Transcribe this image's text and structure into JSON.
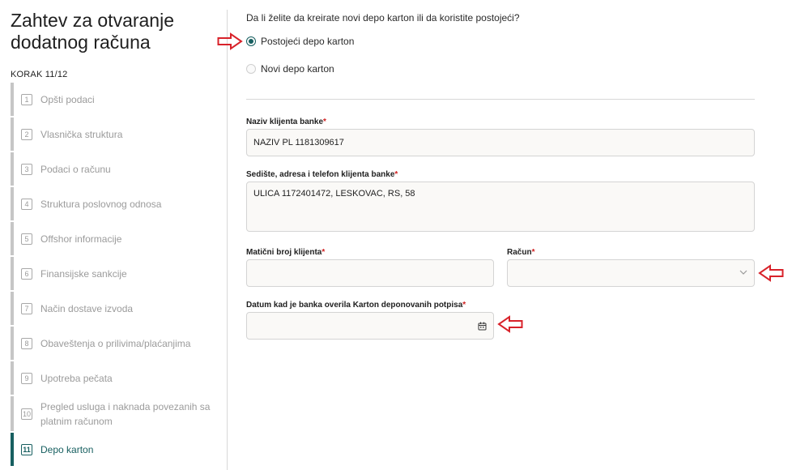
{
  "sidebar": {
    "title": "Zahtev za otvaranje dodatnog računa",
    "step_counter": "KORAK 11/12",
    "steps": [
      {
        "num": "1",
        "label": "Opšti podaci"
      },
      {
        "num": "2",
        "label": "Vlasnička struktura"
      },
      {
        "num": "3",
        "label": "Podaci o računu"
      },
      {
        "num": "4",
        "label": "Struktura poslovnog odnosa"
      },
      {
        "num": "5",
        "label": "Offshor informacije"
      },
      {
        "num": "6",
        "label": "Finansijske sankcije"
      },
      {
        "num": "7",
        "label": "Način dostave izvoda"
      },
      {
        "num": "8",
        "label": "Obaveštenja o prilivima/plaćanjima"
      },
      {
        "num": "9",
        "label": "Upotreba pečata"
      },
      {
        "num": "10",
        "label": "Pregled usluga i naknada povezanih sa platnim računom"
      },
      {
        "num": "11",
        "label": "Depo karton"
      }
    ]
  },
  "form": {
    "question": "Da li želite da kreirate novi depo karton ili da koristite postojeći?",
    "options": [
      {
        "label": "Postojeći depo karton",
        "checked": true
      },
      {
        "label": "Novi depo karton",
        "checked": false
      }
    ],
    "client_name": {
      "label": "Naziv klijenta banke",
      "value": "NAZIV PL 1181309617"
    },
    "address": {
      "label": "Sedište, adresa i telefon klijenta banke",
      "value": "ULICA 1172401472, LESKOVAC, RS, 58"
    },
    "reg_number": {
      "label": "Matični broj klijenta",
      "value": ""
    },
    "account": {
      "label": "Račun",
      "value": ""
    },
    "date": {
      "label": "Datum kad je banka overila Karton deponovanih potpisa",
      "value": ""
    },
    "required_mark": "*"
  },
  "colors": {
    "accent": "#175f60",
    "annotation": "#d8222a",
    "required": "#d02020"
  }
}
